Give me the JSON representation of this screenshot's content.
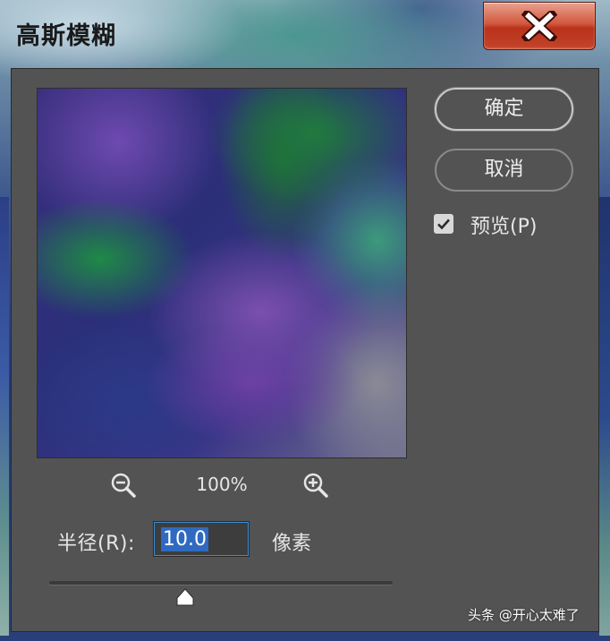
{
  "window": {
    "title": "高斯模糊",
    "close_icon": "close-x-icon"
  },
  "buttons": {
    "ok_label": "确定",
    "cancel_label": "取消"
  },
  "preview_option": {
    "label": "预览(P)",
    "checked": true
  },
  "zoom": {
    "level": "100%",
    "zoom_out_icon": "zoom-out-icon",
    "zoom_in_icon": "zoom-in-icon"
  },
  "radius": {
    "label": "半径(R):",
    "value": "10.0",
    "unit": "像素"
  },
  "watermark": "头条 @开心太难了",
  "colors": {
    "client_bg": "#535353",
    "close_button": "#c4442a",
    "selection": "#2f6ac0"
  }
}
